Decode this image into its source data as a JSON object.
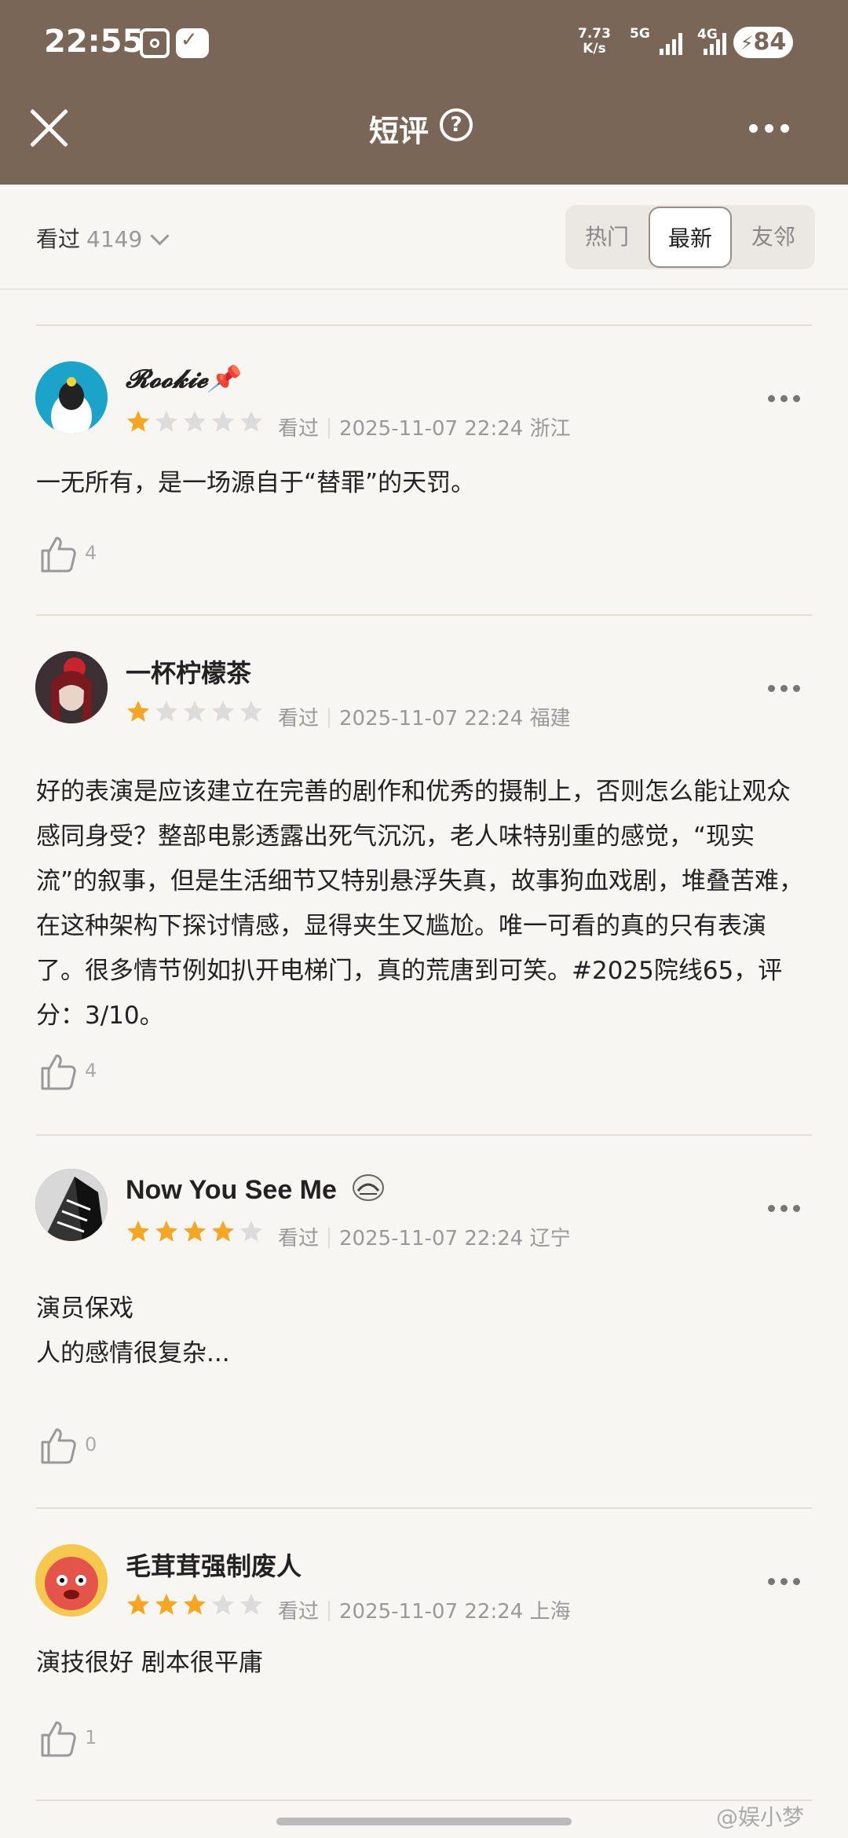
{
  "status_bar": {
    "time": "22:55",
    "speed_value": "7.73",
    "speed_unit": "K/s",
    "net1": "5G",
    "net2": "4G",
    "battery": "84"
  },
  "nav": {
    "title": "短评",
    "help": "?"
  },
  "filter": {
    "watched_label": "看过",
    "watched_count": "4149",
    "tabs": [
      "热门",
      "最新",
      "友邻"
    ],
    "active_tab": "最新"
  },
  "reviews": [
    {
      "username": "𝓡𝓸𝓸𝓴𝓲𝓮📌",
      "rating": 1,
      "status": "看过",
      "datetime": "2025-11-07 22:24",
      "location": "浙江",
      "text": "一无所有，是一场源自于“替罪”的天罚。",
      "likes": "4"
    },
    {
      "username": "一杯柠檬茶",
      "rating": 1,
      "status": "看过",
      "datetime": "2025-11-07 22:24",
      "location": "福建",
      "text": "好的表演是应该建立在完善的剧作和优秀的摄制上，否则怎么能让观众感同身受？整部电影透露出死气沉沉，老人味特别重的感觉，“现实流”的叙事，但是生活细节又特别悬浮失真，故事狗血戏剧，堆叠苦难，在这种架构下探讨情感，显得夹生又尴尬。唯一可看的真的只有表演了。很多情节例如扒开电梯门，真的荒唐到可笑。#2025院线65，评分：3/10。",
      "likes": "4"
    },
    {
      "username": "Now You See Me",
      "rating": 4,
      "status": "看过",
      "datetime": "2025-11-07 22:24",
      "location": "辽宁",
      "text_line1": "演员保戏",
      "text_line2": "人的感情很复杂...",
      "likes": "0"
    },
    {
      "username": "毛茸茸强制废人",
      "rating": 3,
      "status": "看过",
      "datetime": "2025-11-07 22:24",
      "location": "上海",
      "text": "演技很好 剧本很平庸",
      "likes": "1"
    }
  ],
  "watermark": "@娱小梦",
  "colors": {
    "header_bg": "#7a6656",
    "star_on": "#f5a623",
    "star_off": "#dcdcdc",
    "page_bg": "#f8f6f3"
  },
  "icons": [
    "close-icon",
    "help-icon",
    "more-icon",
    "chevron-down-icon",
    "star-icon",
    "thumbs-up-icon"
  ]
}
